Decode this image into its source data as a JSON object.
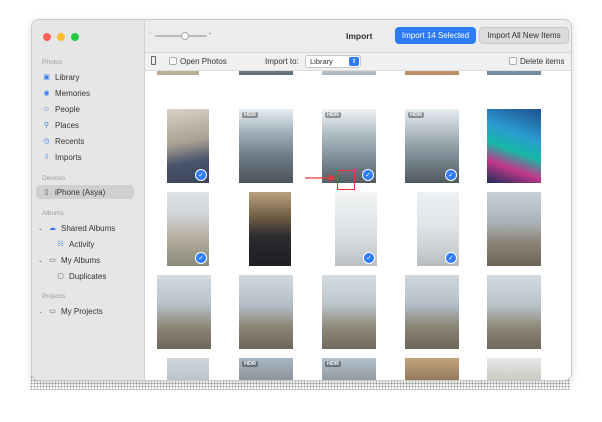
{
  "window": {
    "title": "Import"
  },
  "sidebar": {
    "sections": [
      {
        "label": "Photos"
      },
      {
        "label": "Devices"
      },
      {
        "label": "Albums"
      },
      {
        "label": "Projects"
      }
    ],
    "items": [
      {
        "label": "Library",
        "icon": "photos-icon"
      },
      {
        "label": "Memories",
        "icon": "memories-icon"
      },
      {
        "label": "People",
        "icon": "people-icon"
      },
      {
        "label": "Places",
        "icon": "places-icon"
      },
      {
        "label": "Recents",
        "icon": "clock-icon"
      },
      {
        "label": "Imports",
        "icon": "imports-icon"
      },
      {
        "label": "iPhone (Asya)",
        "icon": "iphone-icon",
        "selected": true
      },
      {
        "label": "Shared Albums",
        "icon": "cloud-icon"
      },
      {
        "label": "Activity",
        "icon": "activity-icon"
      },
      {
        "label": "My Albums",
        "icon": "folder-icon"
      },
      {
        "label": "Duplicates",
        "icon": "album-icon"
      },
      {
        "label": "My Projects",
        "icon": "folder-icon"
      }
    ]
  },
  "toolbar": {
    "import_selected_label": "Import 14 Selected",
    "import_all_label": "Import All New Items"
  },
  "options": {
    "open_photos_label": "Open Photos",
    "import_to_label": "Import to:",
    "import_to_value": "Library",
    "delete_items_label": "Delete items"
  },
  "photos": {
    "hdr_label": "HDR",
    "check_glyph": "✓",
    "accent": "#2d7cf6",
    "annotation_color": "#e03a3a"
  }
}
